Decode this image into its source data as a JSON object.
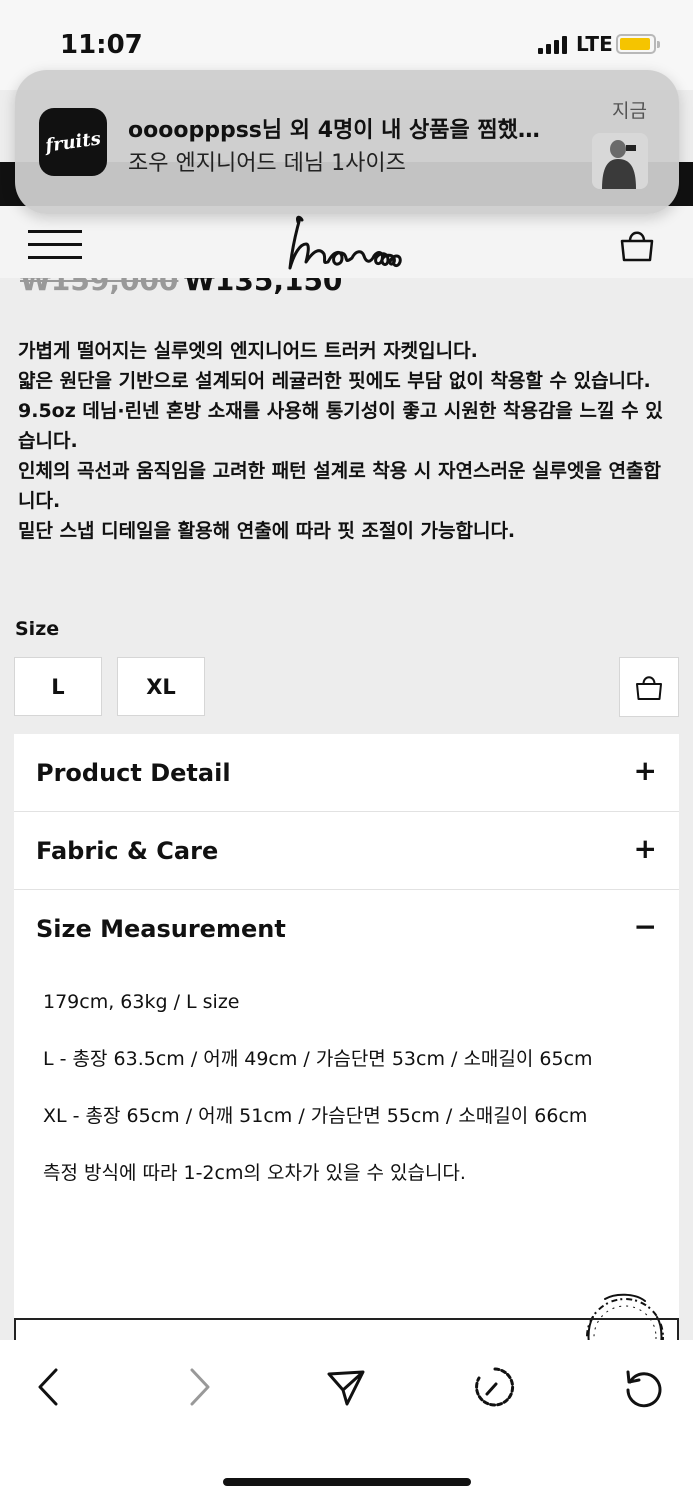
{
  "status_bar": {
    "time": "11:07",
    "network": "LTE"
  },
  "notification": {
    "app": "fruits",
    "app_icon_text": "fruits",
    "title": "oooopppss님 외 4명이 내 상품을 찜했…",
    "body": "조우 엔지니어드 데님 1사이즈",
    "time": "지금"
  },
  "header": {
    "logo_text": "chomoo",
    "menu_icon": "hamburger-icon",
    "bag_icon": "shopping-bag-icon"
  },
  "price": {
    "original": "₩159,000",
    "sale": "₩135,150"
  },
  "description": [
    "가볍게 떨어지는 실루엣의 엔지니어드 트러커 자켓입니다.",
    "얇은 원단을 기반으로 설계되어 레귤러한 핏에도 부담 없이 착용할 수 있습니다.",
    "9.5oz 데님·린넨 혼방 소재를 사용해 통기성이 좋고 시원한 착용감을 느낄 수 있습니다.",
    "인체의 곡선과 움직임을 고려한 패턴 설계로 착용 시 자연스러운 실루엣을 연출합니다.",
    "밑단 스냅 디테일을 활용해 연출에 따라 핏 조절이 가능합니다."
  ],
  "size": {
    "label": "Size",
    "options": [
      "L",
      "XL"
    ]
  },
  "accordion": [
    {
      "title": "Product Detail",
      "sign": "+"
    },
    {
      "title": "Fabric & Care",
      "sign": "+"
    },
    {
      "title": "Size Measurement",
      "sign": "−"
    }
  ],
  "size_measurement": {
    "model": "179cm, 63kg / L size",
    "l": "L - 총장 63.5cm / 어깨 49cm / 가슴단면 53cm / 소매길이 65cm",
    "xl": "XL - 총장 65cm / 어깨 51cm / 가슴단면 55cm / 소매길이 66cm",
    "note": "측정 방식에 따라 1-2cm의 오차가 있을 수 있습니다."
  },
  "toolbar": {
    "back": "back-arrow-icon",
    "forward": "forward-arrow-icon",
    "share": "send-icon",
    "history": "history-icon",
    "refresh": "refresh-icon"
  },
  "colors": {
    "background": "#ededed",
    "notification_bg": "#cdcdcd",
    "battery": "#f5c400"
  }
}
